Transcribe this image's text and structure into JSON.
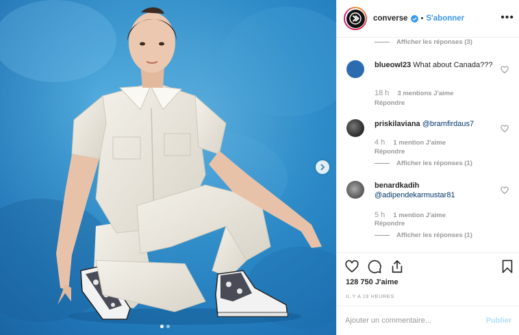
{
  "post": {
    "account": {
      "username": "converse",
      "verified": true,
      "follow_label": "S'abonner",
      "separator": "•",
      "more_label": "•••"
    },
    "photo": {
      "carousel_count": 2,
      "active_index": 0
    },
    "comments": [
      {
        "type": "view-replies",
        "label": "Afficher les réponses (3)"
      },
      {
        "username": "blueowl23",
        "text": "What about Canada???",
        "time": "18 h",
        "likes": "3 mentions J'aime",
        "reply_label": "Répondre",
        "avatar_color": "#2b6cb0"
      },
      {
        "username": "priskilaviana",
        "mention": "@bramfirdaus7",
        "text": "",
        "time": "4 h",
        "likes": "1 mention J'aime",
        "reply_label": "Répondre",
        "view_replies": "Afficher les réponses (1)",
        "avatar_color": "#3a3a3a"
      },
      {
        "username": "benardkadih",
        "mention": "@adipendekarmustar81",
        "text": "",
        "time": "5 h",
        "likes": "1 mention J'aime",
        "reply_label": "Répondre",
        "view_replies": "Afficher les réponses (1)",
        "avatar_color": "#6b6b6b"
      }
    ],
    "actions": {
      "like_icon": "heart-outline-icon",
      "comment_icon": "comment-bubble-icon",
      "share_icon": "share-upload-icon",
      "save_icon": "bookmark-icon"
    },
    "likes_count": "128 750 J'aime",
    "timestamp": "IL Y A 19 HEURES",
    "add_comment": {
      "placeholder": "Ajouter un commentaire...",
      "publish_label": "Publier"
    },
    "colors": {
      "link_blue": "#3897f0",
      "publish_disabled": "#b2dffc",
      "meta_grey": "#999999",
      "photo_blue": "#2f8fcb"
    }
  }
}
